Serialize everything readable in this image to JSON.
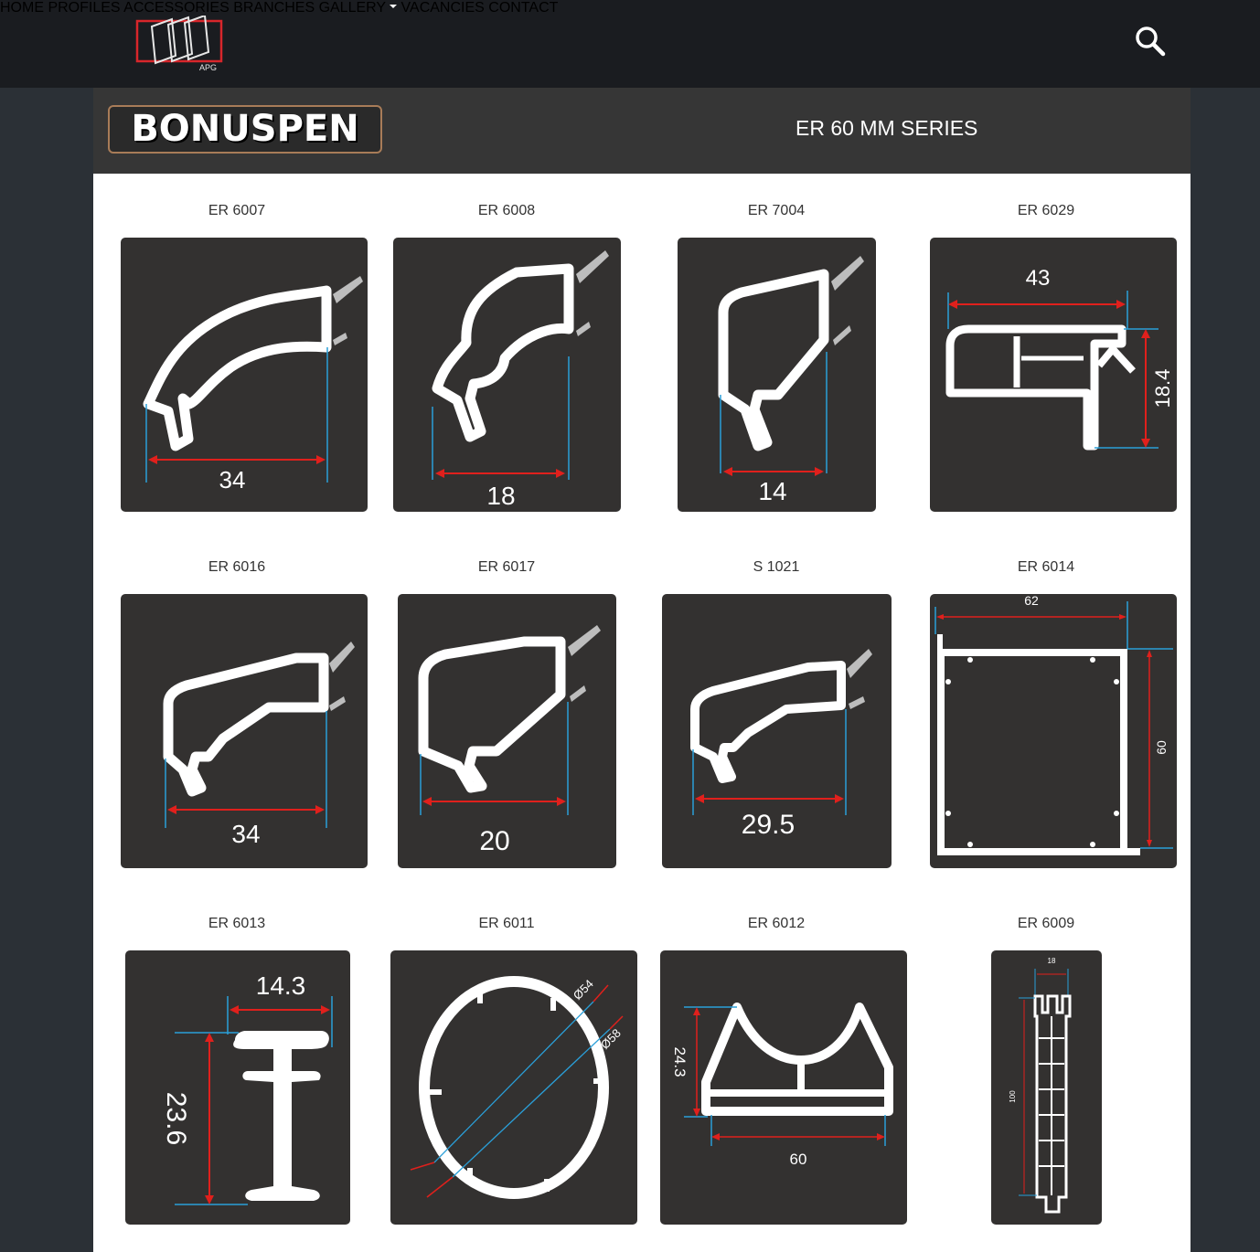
{
  "header": {
    "logo_text": "APG",
    "nav": [
      {
        "label": "HOME"
      },
      {
        "label": "PROFILES"
      },
      {
        "label": "ACCESSORIES"
      },
      {
        "label": "BRANCHES"
      },
      {
        "label": "GALLERY"
      },
      {
        "label": "VACANCIES"
      },
      {
        "label": "CONTACT"
      }
    ],
    "search_icon": "search-icon"
  },
  "series": {
    "brand": "BONUSPEN",
    "title": "ER 60 MM SERIES"
  },
  "products": [
    {
      "code": "ER 6007",
      "dims": [
        "34"
      ]
    },
    {
      "code": "ER 6008",
      "dims": [
        "18"
      ]
    },
    {
      "code": "ER 7004",
      "dims": [
        "14"
      ]
    },
    {
      "code": "ER 6029",
      "dims": [
        "43",
        "18.4"
      ]
    },
    {
      "code": "ER 6016",
      "dims": [
        "34"
      ]
    },
    {
      "code": "ER 6017",
      "dims": [
        "20"
      ]
    },
    {
      "code": "S 1021",
      "dims": [
        "29.5"
      ]
    },
    {
      "code": "ER 6014",
      "dims": [
        "62",
        "60"
      ]
    },
    {
      "code": "ER 6013",
      "dims": [
        "14.3",
        "23.6"
      ]
    },
    {
      "code": "ER 6011",
      "dims": [
        "Ø54",
        "Ø58"
      ]
    },
    {
      "code": "ER 6012",
      "dims": [
        "24.3",
        "60"
      ]
    },
    {
      "code": "ER 6009",
      "dims": [
        "18",
        "100"
      ]
    }
  ],
  "colors": {
    "topbar": "#1a1c20",
    "page_bg": "#2b3036",
    "card_bg": "#333130",
    "dimension_red": "#e0201c",
    "dimension_blue": "#2a9fd8"
  }
}
